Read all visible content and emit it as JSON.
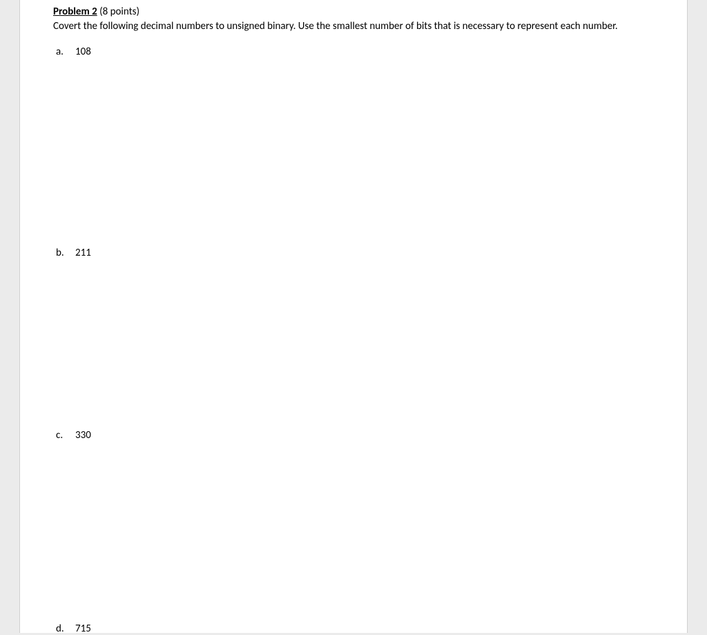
{
  "problem": {
    "title": "Problem 2",
    "points": "(8 points)",
    "instructions": "Covert the following decimal numbers to unsigned binary. Use the smallest number of bits that is necessary to represent each number.",
    "items": [
      {
        "label": "a.",
        "value": "108"
      },
      {
        "label": "b.",
        "value": "211"
      },
      {
        "label": "c.",
        "value": "330"
      },
      {
        "label": "d.",
        "value": "715"
      }
    ]
  }
}
